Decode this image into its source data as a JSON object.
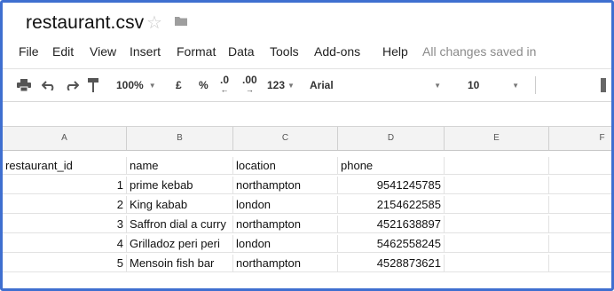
{
  "document": {
    "title": "restaurant.csv"
  },
  "menu": {
    "items": [
      "File",
      "Edit",
      "View",
      "Insert",
      "Format",
      "Data",
      "Tools",
      "Add-ons",
      "Help"
    ],
    "save_status": "All changes saved in"
  },
  "toolbar": {
    "zoom": "100%",
    "currency": "£",
    "percent": "%",
    "decrease_decimal": ".0",
    "increase_decimal": ".00",
    "more_formats": "123",
    "font": "Arial",
    "font_size": "10"
  },
  "grid": {
    "columns": [
      "A",
      "B",
      "C",
      "D",
      "E",
      "F"
    ],
    "rows": [
      [
        "restaurant_id",
        "name",
        "location",
        "phone",
        "",
        ""
      ],
      [
        "1",
        "prime kebab",
        "northampton",
        "9541245785",
        "",
        ""
      ],
      [
        "2",
        "King kabab",
        "london",
        "2154622585",
        "",
        ""
      ],
      [
        "3",
        "Saffron dial a curry",
        "northampton",
        "4521638897",
        "",
        ""
      ],
      [
        "4",
        "Grilladoz peri peri",
        "london",
        "5462558245",
        "",
        ""
      ],
      [
        "5",
        "Mensoin fish bar",
        "northampton",
        "4528873621",
        "",
        ""
      ]
    ]
  }
}
